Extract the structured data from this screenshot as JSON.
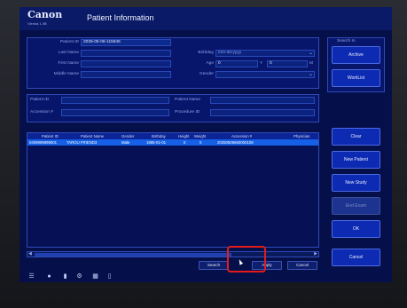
{
  "window": {
    "brand": "Canon",
    "brand_sub": "Vienna 1.0B",
    "title": "Patient Information"
  },
  "patient_form": {
    "patient_id_label": "Patient ID",
    "patient_id_value": "2025-05-06-115945",
    "last_name_label": "Last Name",
    "first_name_label": "First Name",
    "middle_name_label": "Middle Name",
    "birthday_label": "Birthday",
    "birthday_placeholder": "mm-dd-yyyy",
    "age_label": "Age",
    "age_value": "0",
    "age_months_value": "0",
    "age_unit_years": "Y",
    "age_unit_months": "M",
    "gender_label": "Gender"
  },
  "search_panel": {
    "title": "Search In",
    "archive": "Archive",
    "worklist": "WorkList"
  },
  "search_fields": {
    "patient_id_label": "Patient ID",
    "patient_name_label": "Patient Name",
    "accession_label": "Accession #",
    "procedure_id_label": "Procedure ID"
  },
  "grid": {
    "columns": [
      "Patient ID",
      "Patient Name",
      "Gender",
      "Birthday",
      "Height",
      "Weight",
      "Accession #",
      "Physician"
    ],
    "rows": [
      {
        "patient_id": "0409999999001",
        "patient_name": "TAROU FRIEND3",
        "gender": "Male",
        "birthday": "1985-01-01",
        "height": "0",
        "weight": "0",
        "accession": "20250506660000108",
        "physician": ""
      }
    ]
  },
  "bottom_buttons": {
    "search": "Search",
    "apply": "Apply",
    "cancel": "Cancel"
  },
  "side_buttons": {
    "clear": "Clear",
    "new_patient": "New Patient",
    "new_study": "New Study",
    "end_exam": "End Exam",
    "ok": "OK",
    "cancel": "Cancel"
  },
  "taskbar_icons": [
    "network-icon",
    "user-icon",
    "document-icon",
    "gear-icon",
    "monitor-icon",
    "battery-icon"
  ],
  "colors": {
    "screen_bg": "#05104a",
    "panel_bg": "#07166a",
    "selected_row": "#1560e6",
    "highlight": "#e31b1b"
  }
}
